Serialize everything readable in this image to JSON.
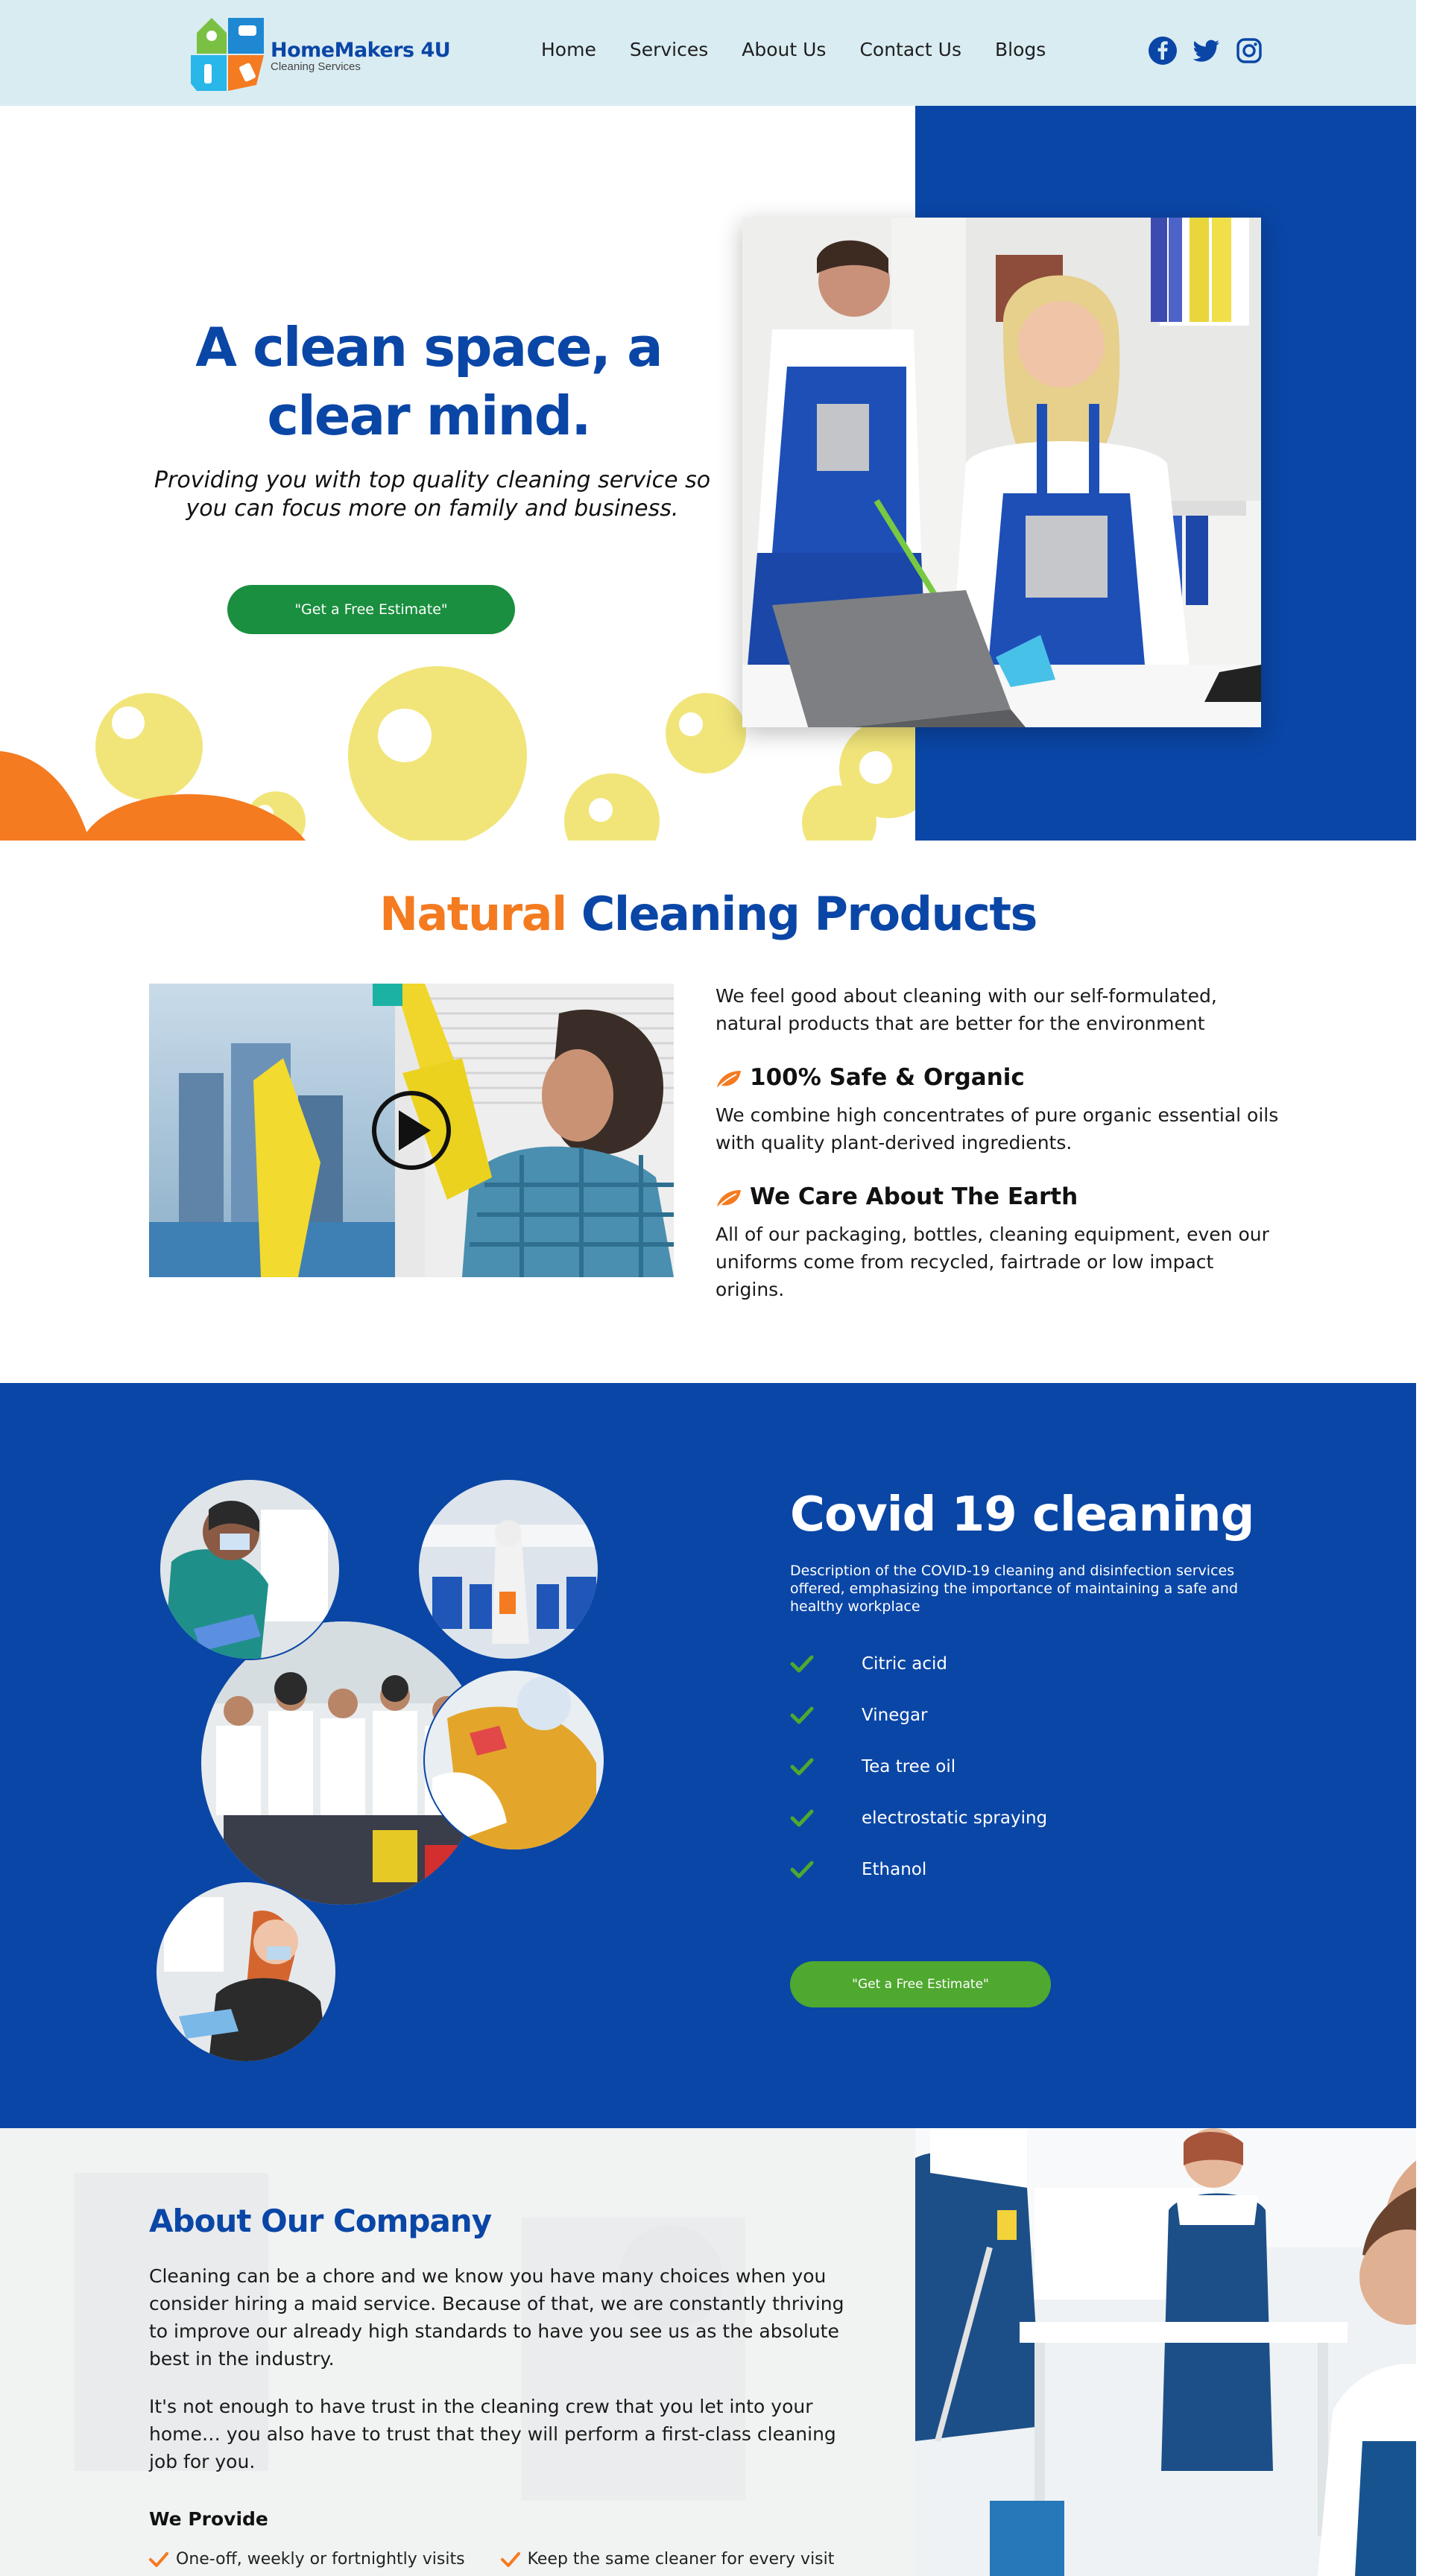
{
  "header": {
    "brand_name": "HomeMakers 4U",
    "brand_tagline": "Cleaning Services",
    "nav": [
      "Home",
      "Services",
      "About Us",
      "Contact Us",
      "Blogs"
    ],
    "social": [
      "facebook-icon",
      "twitter-icon",
      "instagram-icon"
    ]
  },
  "hero": {
    "title": "A clean space, a clear mind.",
    "subtitle": "Providing you with top quality cleaning service so you can focus more on family and business.",
    "cta": "\"Get a Free Estimate\""
  },
  "natural": {
    "title_accent": "Natural",
    "title_rest": "Cleaning Products",
    "lead": "We feel good about cleaning with our self-formulated, natural products that are better for the environment",
    "features": [
      {
        "title": "100% Safe & Organic",
        "body": "We combine high concentrates of pure organic essential oils with quality plant-derived ingredients."
      },
      {
        "title": "We Care About The Earth",
        "body": "All of our packaging, bottles, cleaning equipment, even our uniforms come from recycled, fairtrade or low impact origins."
      }
    ]
  },
  "covid": {
    "title": "Covid 19 cleaning",
    "description": "Description of the COVID-19 cleaning and disinfection services offered, emphasizing the importance of maintaining a safe and healthy workplace",
    "items": [
      "Citric acid",
      "Vinegar",
      "Tea tree oil",
      "electrostatic spraying",
      "Ethanol"
    ],
    "cta": "\"Get a Free Estimate\""
  },
  "about": {
    "title": "About Our Company",
    "p1": "Cleaning can be a chore and we know you have many choices when you consider hiring a maid service. Because of that, we are constantly thriving to improve our already high standards to have you see us as the absolute best in the industry.",
    "p2": "It's not enough to have trust in the cleaning crew that you let into your home… you also have to trust that they will perform a first-class cleaning job for you.",
    "provide_title": "We Provide",
    "provide_items": [
      "One-off, weekly or fortnightly visits",
      "Keep the same cleaner for every visit"
    ]
  },
  "colors": {
    "brand_blue": "#0a46a6",
    "accent_orange": "#f47b20",
    "header_bg": "#d9ecf2",
    "cta_green": "#1a8f3f",
    "covid_cta_green": "#4fa82f",
    "bubble_yellow": "#f1e57a"
  }
}
